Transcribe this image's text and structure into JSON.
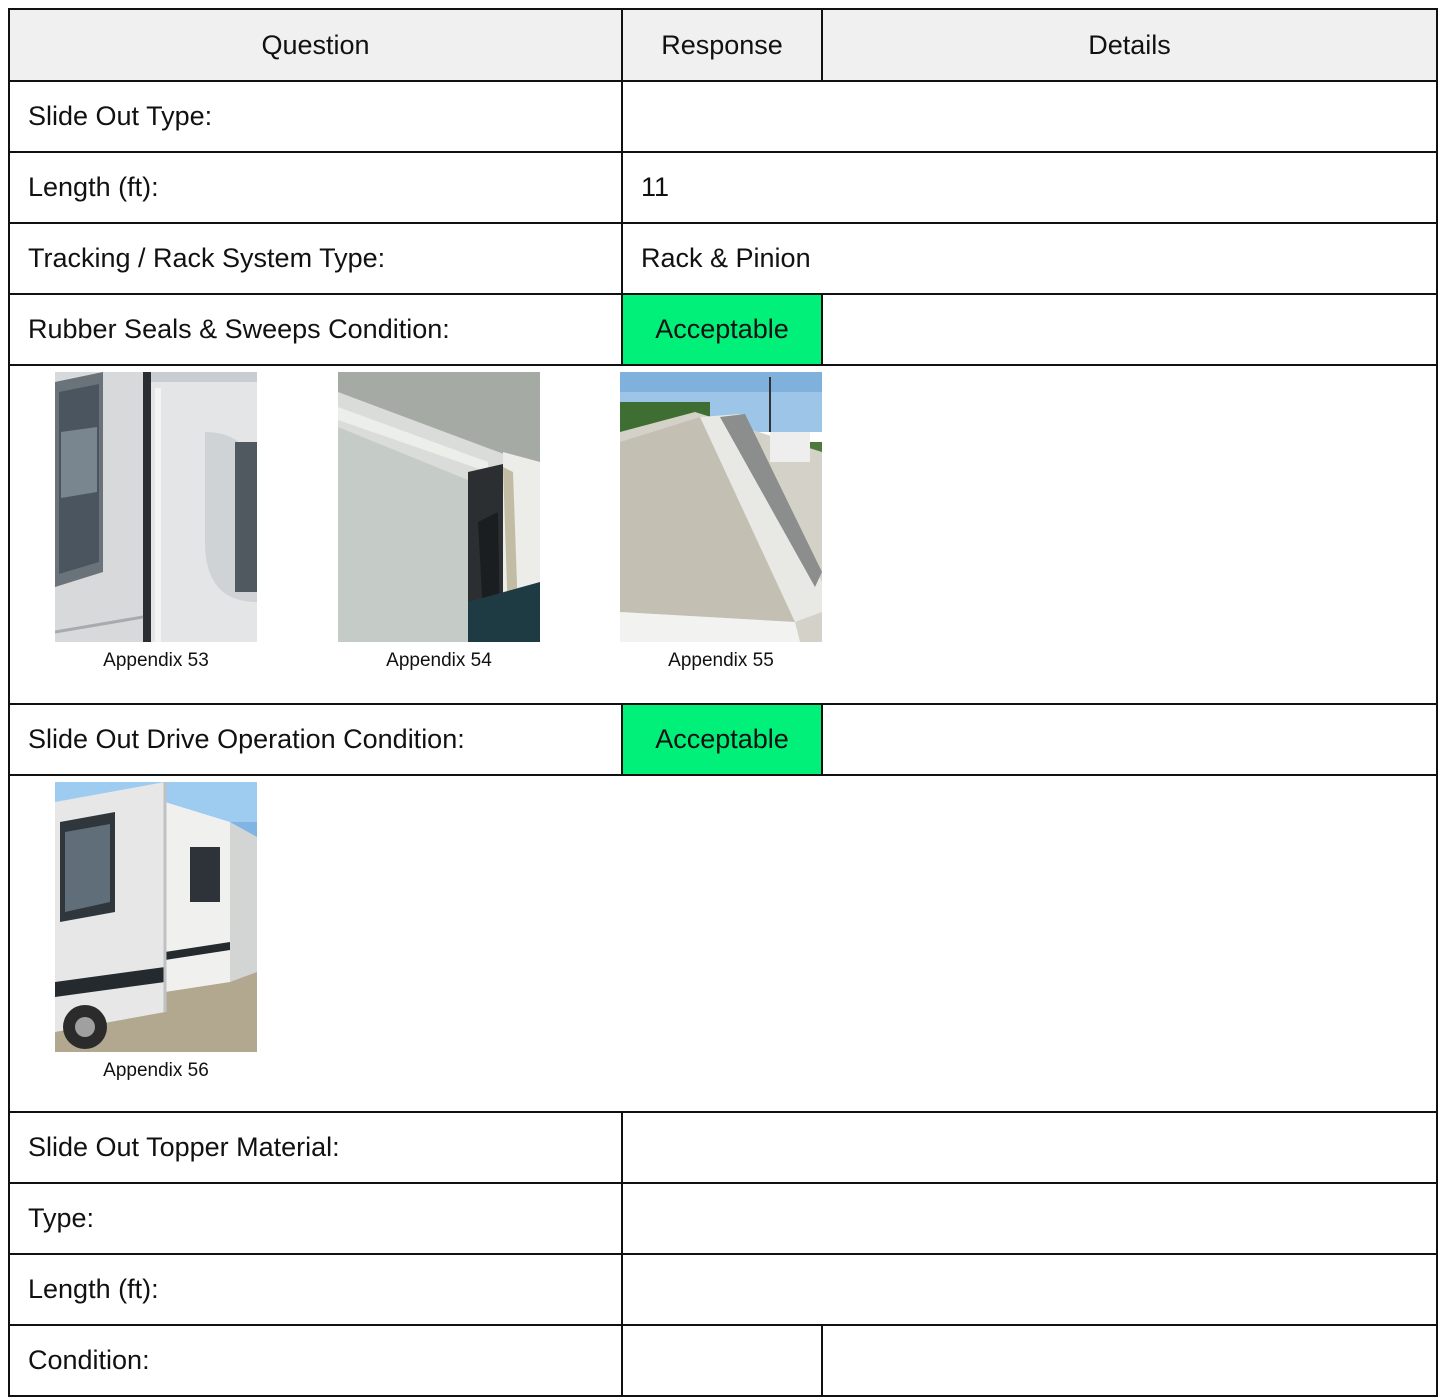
{
  "header": {
    "question": "Question",
    "response": "Response",
    "details": "Details"
  },
  "rows": {
    "slide_out_type": {
      "question": "Slide Out Type:",
      "response": ""
    },
    "length_ft": {
      "question": "Length (ft):",
      "response": "11"
    },
    "tracking": {
      "question": "Tracking / Rack System Type:",
      "response": "Rack & Pinion"
    },
    "rubber_seals": {
      "question": "Rubber Seals & Sweeps Condition:",
      "response": "Acceptable",
      "details": ""
    },
    "drive_operation": {
      "question": "Slide Out Drive Operation Condition:",
      "response": "Acceptable",
      "details": ""
    },
    "topper_material": {
      "question": "Slide Out Topper Material:",
      "response": ""
    },
    "type": {
      "question": "Type:",
      "response": ""
    },
    "topper_length": {
      "question": "Length (ft):",
      "response": ""
    },
    "condition": {
      "question": "Condition:",
      "response": "",
      "details": ""
    }
  },
  "photos": {
    "rubber_seals": [
      {
        "caption": "Appendix 53"
      },
      {
        "caption": "Appendix 54"
      },
      {
        "caption": "Appendix 55"
      }
    ],
    "drive_operation": [
      {
        "caption": "Appendix 56"
      }
    ]
  },
  "colors": {
    "acceptable": "#00f07a",
    "header_bg": "#f0f0f0",
    "border": "#111111"
  }
}
